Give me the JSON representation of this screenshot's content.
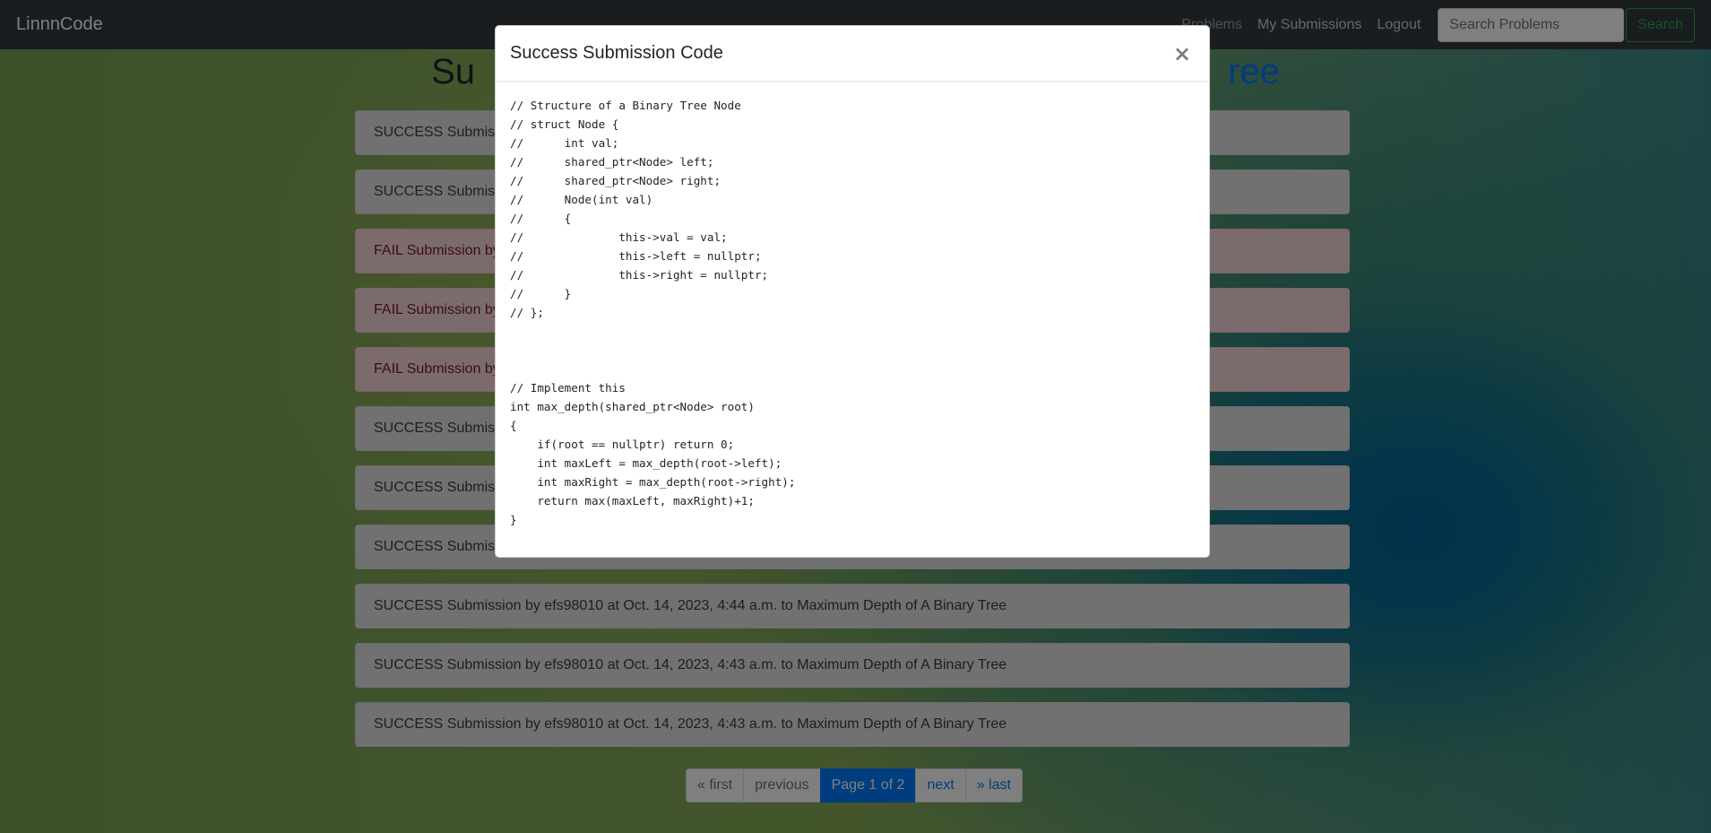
{
  "navbar": {
    "brand": "LinnnCode",
    "links": [
      "Problems",
      "My Submissions",
      "Logout"
    ],
    "search_placeholder": "Search Problems",
    "search_button": "Search"
  },
  "page": {
    "title_prefix": "Su",
    "title_link_suffix": "ree"
  },
  "submissions": [
    {
      "status": "success",
      "text": "SUCCESS Submissio"
    },
    {
      "status": "success",
      "text": "SUCCESS Submissio"
    },
    {
      "status": "fail",
      "text": "FAIL Submission by"
    },
    {
      "status": "fail",
      "text": "FAIL Submission by"
    },
    {
      "status": "fail",
      "text": "FAIL Submission by"
    },
    {
      "status": "success",
      "text": "SUCCESS Submissio"
    },
    {
      "status": "success",
      "text": "SUCCESS Submissio"
    },
    {
      "status": "success",
      "text": "SUCCESS Submissio"
    },
    {
      "status": "success",
      "text": "SUCCESS Submission by efs98010 at Oct. 14, 2023, 4:44 a.m. to Maximum Depth of A Binary Tree"
    },
    {
      "status": "success",
      "text": "SUCCESS Submission by efs98010 at Oct. 14, 2023, 4:43 a.m. to Maximum Depth of A Binary Tree"
    },
    {
      "status": "success",
      "text": "SUCCESS Submission by efs98010 at Oct. 14, 2023, 4:43 a.m. to Maximum Depth of A Binary Tree"
    }
  ],
  "pagination": {
    "first": "« first",
    "previous": "previous",
    "current": "Page 1 of 2",
    "next": "next",
    "last": "» last"
  },
  "modal": {
    "title": "Success Submission Code",
    "close_glyph": "×",
    "code": "// Structure of a Binary Tree Node\n// struct Node {\n//      int val;\n//      shared_ptr<Node> left;\n//      shared_ptr<Node> right;\n//      Node(int val)\n//      {\n//              this->val = val;\n//              this->left = nullptr;\n//              this->right = nullptr;\n//      }\n// };\n\n\n\n// Implement this\nint max_depth(shared_ptr<Node> root)\n{\n    if(root == nullptr) return 0;\n    int maxLeft = max_depth(root->left);\n    int maxRight = max_depth(root->right);\n    return max(maxLeft, maxRight)+1;\n}"
  }
}
